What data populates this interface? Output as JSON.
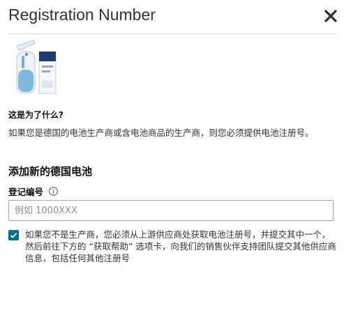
{
  "dialog": {
    "title": "Registration Number",
    "close_icon": "close-icon"
  },
  "product_image": "handheld water flosser with box",
  "why": {
    "heading": "这是为了什么?",
    "text": "如果您是德国的电池生产商或含电池商品的生产商，则您必须提供电池注册号。"
  },
  "section_title": "添加新的德国电池",
  "field": {
    "label": "登记编号",
    "info_icon": "info-icon",
    "placeholder": "例如 1000XXX",
    "value": ""
  },
  "checkbox": {
    "checked": true,
    "text": "如果您不是生产商，您必须从上游供应商处获取电池注册号，并提交其中一个，然后前往下方的 “获取帮助” 选项卡，向我们的销售伙伴支持团队提交其他供应商信息，包括任何其他注册号"
  },
  "colors": {
    "accent": "#007185",
    "divider": "#d5d9d9",
    "input_border": "#a6a6a6"
  }
}
